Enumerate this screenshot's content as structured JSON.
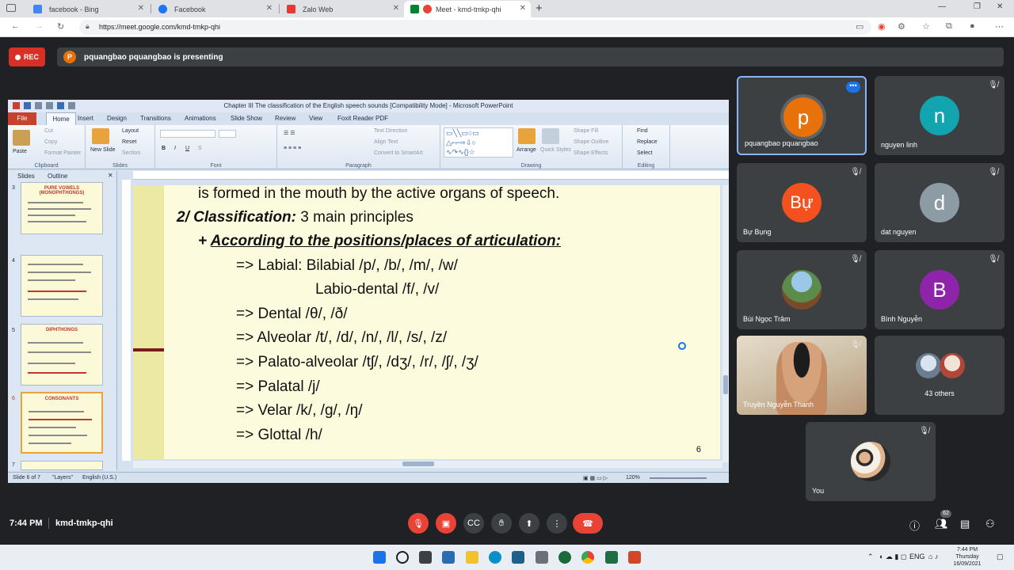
{
  "browser": {
    "tabs": [
      {
        "label": "facebook - Bing",
        "color": "#4285f4"
      },
      {
        "label": "Facebook",
        "color": "#1877f2"
      },
      {
        "label": "Zalo Web",
        "color": "#e53935"
      },
      {
        "label": "Meet - kmd-tmkp-qhi",
        "color": "#ea4335"
      }
    ],
    "new_tab": "+",
    "url": "https://meet.google.com/kmd-tmkp-qhi",
    "win_min": "—",
    "win_max": "❐",
    "win_close": "✕"
  },
  "meet": {
    "rec_label": "REC",
    "presenter_initial": "P",
    "presenting_text": "pquangbao pquangbao is presenting",
    "time": "7:44 PM",
    "meeting_code": "kmd-tmkp-qhi",
    "people_count": "62"
  },
  "ppt": {
    "window_title": "Chapter III The classification of the English speech sounds [Compatibility Mode] - Microsoft PowerPoint",
    "file_tab": "File",
    "tabs": [
      "Home",
      "Insert",
      "Design",
      "Transitions",
      "Animations",
      "Slide Show",
      "Review",
      "View",
      "Foxit Reader PDF"
    ],
    "ribbon": {
      "paste": "Paste",
      "cut": "Cut",
      "copy": "Copy",
      "format_painter": "Format Painter",
      "clipboard": "Clipboard",
      "new_slide": "New Slide",
      "layout": "Layout",
      "reset": "Reset",
      "section": "Section",
      "slides": "Slides",
      "font": "Font",
      "text_direction": "Text Direction",
      "align_text": "Align Text",
      "convert_smartart": "Convert to SmartArt",
      "paragraph": "Paragraph",
      "arrange": "Arrange",
      "quick_styles": "Quick Styles",
      "shape_fill": "Shape Fill",
      "shape_outline": "Shape Outline",
      "shape_effects": "Shape Effects",
      "drawing": "Drawing",
      "find": "Find",
      "replace": "Replace",
      "select": "Select",
      "editing": "Editing"
    },
    "pane_tabs": [
      "Slides",
      "Outline"
    ],
    "thumbs": [
      {
        "num": "3",
        "title": "PURE VOWELS (MONOPHTHONGS)"
      },
      {
        "num": "4",
        "title": ""
      },
      {
        "num": "5",
        "title": "DIPHTHONGS"
      },
      {
        "num": "6",
        "title": "CONSONANTS"
      },
      {
        "num": "7",
        "title": ""
      }
    ],
    "slide": {
      "line1": "is formed in the mouth by the active organs of speech.",
      "heading_bold": "2/ Classification:",
      "heading_rest": " 3 main principles",
      "subheading_plus": "+ ",
      "subheading": "According to the positions/places of articulation:",
      "items": [
        "=> Labial:  Bilabial /p/, /b/, /m/, /w/",
        "Labio-dental  /f/, /v/",
        "=> Dental /θ/, /ð/",
        "=> Alveolar  /t/, /d/, /n/, /l/, /s/, /z/",
        "=> Palato-alveolar  /tʃ/, /dʒ/, /r/, /ʃ/, /ʒ/",
        "=> Palatal  /j/",
        "=> Velar /k/, /g/, /ŋ/",
        "=> Glottal /h/"
      ],
      "page_number": "6"
    },
    "status": {
      "slide_of": "Slide 6 of 7",
      "theme": "\"Layers\"",
      "language": "English (U.S.)",
      "zoom": "120%"
    }
  },
  "participants": [
    {
      "name": "pquangbao pquangbao",
      "initial": "p",
      "color": "#e8710a"
    },
    {
      "name": "nguyen linh",
      "initial": "n",
      "color": "#12a4af"
    },
    {
      "name": "Bự Bụng",
      "initial": "Bự",
      "color": "#f4511e"
    },
    {
      "name": "dat nguyen",
      "initial": "d",
      "color": "#8d9ba5"
    },
    {
      "name": "Bùi Ngọc Trâm",
      "initial": "",
      "color": "#4f7a4a"
    },
    {
      "name": "Bình Nguyễn",
      "initial": "B",
      "color": "#8e24aa"
    },
    {
      "name": "Truyền Nguyễn Thanh",
      "initial": "",
      "color": "#c9b79c"
    },
    {
      "name": "43 others",
      "initial": "",
      "color": "#3c4043"
    },
    {
      "name": "You",
      "initial": "",
      "color": "#b07a45"
    }
  ],
  "taskbar": {
    "lang": "ENG",
    "clock_time": "7:44 PM",
    "clock_day": "Thursday",
    "clock_date": "16/09/2021"
  }
}
